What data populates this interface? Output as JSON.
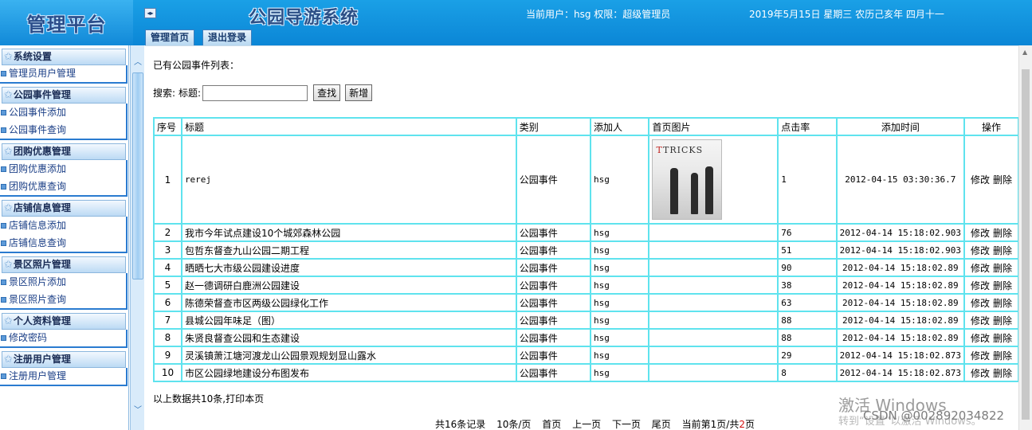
{
  "header": {
    "brand": "管理平台",
    "system_title": "公园导游系统",
    "user_info": "当前用户：hsg 权限：超级管理员",
    "date_info": "2019年5月15日 星期三 农历己亥年 四月十一",
    "tabs": [
      "管理首页",
      "退出登录"
    ]
  },
  "sidebar": {
    "groups": [
      {
        "title": "系统设置",
        "items": [
          "管理员用户管理"
        ]
      },
      {
        "title": "公园事件管理",
        "items": [
          "公园事件添加",
          "公园事件查询"
        ]
      },
      {
        "title": "团购优惠管理",
        "items": [
          "团购优惠添加",
          "团购优惠查询"
        ]
      },
      {
        "title": "店铺信息管理",
        "items": [
          "店铺信息添加",
          "店铺信息查询"
        ]
      },
      {
        "title": "景区照片管理",
        "items": [
          "景区照片添加",
          "景区照片查询"
        ]
      },
      {
        "title": "个人资料管理",
        "items": [
          "修改密码"
        ]
      },
      {
        "title": "注册用户管理",
        "items": [
          "注册用户管理"
        ]
      }
    ]
  },
  "main": {
    "list_title": "已有公园事件列表：",
    "search": {
      "label": "搜索:",
      "field_label": "标题:",
      "value": "",
      "search_button": "查找",
      "add_button": "新增"
    },
    "columns": [
      "序号",
      "标题",
      "类别",
      "添加人",
      "首页图片",
      "点击率",
      "添加时间",
      "操作"
    ],
    "rows": [
      {
        "num": "1",
        "title": "rerej",
        "type": "公园事件",
        "adder": "hsg",
        "image": "TRICKS",
        "clicks": "1",
        "time": "2012-04-15 03:30:36.7"
      },
      {
        "num": "2",
        "title": "我市今年试点建设10个城郊森林公园",
        "type": "公园事件",
        "adder": "hsg",
        "image": "",
        "clicks": "76",
        "time": "2012-04-14 15:18:02.903"
      },
      {
        "num": "3",
        "title": "包哲东督查九山公园二期工程",
        "type": "公园事件",
        "adder": "hsg",
        "image": "",
        "clicks": "51",
        "time": "2012-04-14 15:18:02.903"
      },
      {
        "num": "4",
        "title": "晒晒七大市级公园建设进度",
        "type": "公园事件",
        "adder": "hsg",
        "image": "",
        "clicks": "90",
        "time": "2012-04-14 15:18:02.89"
      },
      {
        "num": "5",
        "title": "赵一德调研白鹿洲公园建设",
        "type": "公园事件",
        "adder": "hsg",
        "image": "",
        "clicks": "38",
        "time": "2012-04-14 15:18:02.89"
      },
      {
        "num": "6",
        "title": "陈德荣督查市区两级公园绿化工作",
        "type": "公园事件",
        "adder": "hsg",
        "image": "",
        "clicks": "63",
        "time": "2012-04-14 15:18:02.89"
      },
      {
        "num": "7",
        "title": "县城公园年味足（图）",
        "type": "公园事件",
        "adder": "hsg",
        "image": "",
        "clicks": "88",
        "time": "2012-04-14 15:18:02.89"
      },
      {
        "num": "8",
        "title": "朱贤良督查公园和生态建设",
        "type": "公园事件",
        "adder": "hsg",
        "image": "",
        "clicks": "88",
        "time": "2012-04-14 15:18:02.89"
      },
      {
        "num": "9",
        "title": "灵溪镇萧江塘河渡龙山公园景观规划显山露水",
        "type": "公园事件",
        "adder": "hsg",
        "image": "",
        "clicks": "29",
        "time": "2012-04-14 15:18:02.873"
      },
      {
        "num": "10",
        "title": "市区公园绿地建设分布图发布",
        "type": "公园事件",
        "adder": "hsg",
        "image": "",
        "clicks": "8",
        "time": "2012-04-14 15:18:02.873"
      }
    ],
    "ops": {
      "edit": "修改",
      "delete": "删除"
    },
    "footer_count": "以上数据共10条,打印本页",
    "pager": {
      "total": "共16条记录",
      "per_page": "10条/页",
      "first": "首页",
      "prev": "上一页",
      "next": "下一页",
      "last": "尾页",
      "current_prefix": "当前第",
      "current": "1",
      "current_mid": "页/共",
      "total_pages": "2",
      "current_suffix": "页"
    }
  },
  "overlay": {
    "activate_windows": "激活 Windows",
    "activate_hint": "转到“设置”以激活 Windows。",
    "csdn": "CSDN @002892034822"
  },
  "colors": {
    "header_blue": "#0b86d6",
    "table_border": "#5fe3ee",
    "pager_red": "#d01010"
  }
}
